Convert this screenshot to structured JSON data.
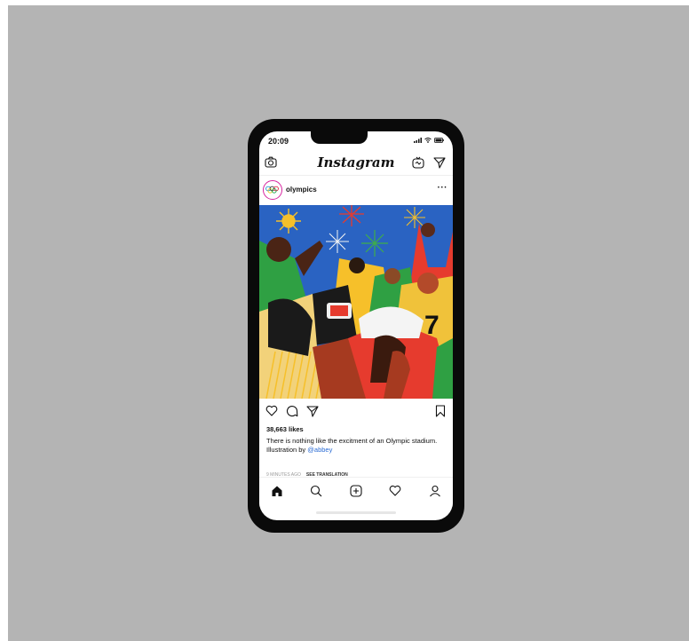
{
  "status_bar": {
    "time": "20:09"
  },
  "header": {
    "app_title": "Instagram"
  },
  "post": {
    "username": "olympics",
    "more_label": "···",
    "likes": "38,663 likes",
    "caption": "There is nothing like the excitment of an Olympic stadium. Illustration by ",
    "mention": "@abbey",
    "timestamp": "9 MINUTES AGO",
    "see_translation": "SEE TRANSLATION"
  },
  "icons": {
    "top_left": "camera-icon",
    "top_right": [
      "igtv-icon",
      "direct-message-icon"
    ],
    "post_actions": [
      "heart-icon",
      "comment-icon",
      "share-icon",
      "bookmark-icon"
    ],
    "bottom_nav": [
      "home-icon",
      "search-icon",
      "new-post-icon",
      "activity-icon",
      "profile-icon"
    ]
  },
  "colors": {
    "mention": "#2b6cd4",
    "background": "#b4b4b4",
    "phone_frame": "#0a0a0a"
  }
}
